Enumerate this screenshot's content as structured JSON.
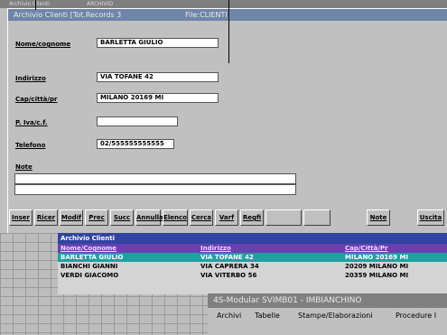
{
  "top_strip": {
    "left_text": "Archivio Clienti",
    "mid_text": "ARCHIVIO"
  },
  "form": {
    "title": "Archivio Clienti [Tot.Records 3",
    "file_label": "File:CLIENTI]",
    "fields": [
      {
        "label": "Nome/cognome",
        "value": "BARLETTA GIULIO"
      },
      {
        "label": "Indirizzo",
        "value": "VIA TOFANE 42"
      },
      {
        "label": "Cap/città/pr",
        "value": "MILANO 20169 MI"
      },
      {
        "label": "P. Iva/c.f.",
        "value": ""
      },
      {
        "label": "Telefono",
        "value": "02/555555555555"
      }
    ],
    "note_label": "Note",
    "buttons": [
      "Inser",
      "Ricer",
      "Modif",
      "Prec",
      "Succ",
      "Annulla",
      "Elenco",
      "Cerca",
      "Varf",
      "Regfi",
      "Note",
      "Uscita"
    ]
  },
  "list": {
    "title": "Archivio Clienti",
    "columns": [
      "Nome/Cognome",
      "Indirizzo",
      "Cap/Città/Pr"
    ],
    "rows": [
      [
        "BARLETTA GIULIO",
        "VIA TOFANE 42",
        "MILANO 20169 MI"
      ],
      [
        "BIANCHI GIANNI",
        "VIA CAPRERA 34",
        "20209 MILANO MI"
      ],
      [
        "VERDI GIACOMO",
        "VIA VITERBO 56",
        "20359 MILANO MI"
      ]
    ]
  },
  "app": {
    "title": "4S-Modular SVIMB01 - IMBIANCHINO",
    "menu": [
      "Archivi",
      "Tabelle",
      "Stampe/Elaborazioni",
      "Procedure I"
    ]
  },
  "colors": {
    "selected_row": "#20a0a0",
    "list_title": "#2f45a0",
    "list_header": "#6a3fb0"
  }
}
